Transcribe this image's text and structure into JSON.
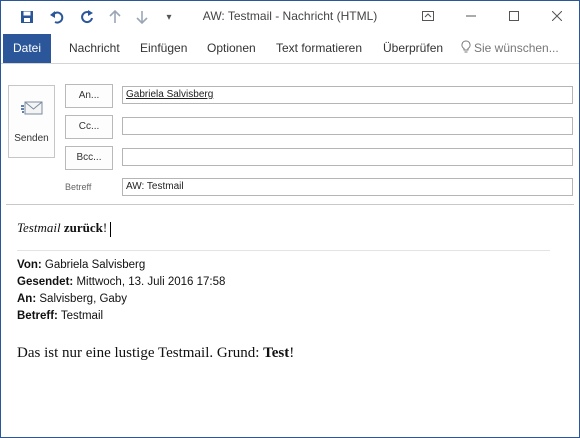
{
  "window": {
    "title": "AW: Testmail  -  Nachricht (HTML)"
  },
  "ribbon": {
    "tabs": [
      "Datei",
      "Nachricht",
      "Einfügen",
      "Optionen",
      "Text formatieren",
      "Überprüfen"
    ],
    "tell_me": "Sie wünschen..."
  },
  "header": {
    "send_label": "Senden",
    "to_label": "An...",
    "cc_label": "Cc...",
    "bcc_label": "Bcc...",
    "subject_label": "Betreff",
    "to_value": "Gabriela Salvisberg",
    "cc_value": "",
    "bcc_value": "",
    "subject_value": "AW: Testmail"
  },
  "body": {
    "reply_italic": "Testmail",
    "reply_bold": "zurück",
    "reply_end": "!",
    "from_label": "Von:",
    "from_value": "Gabriela Salvisberg",
    "sent_label": "Gesendet:",
    "sent_value": "Mittwoch, 13. Juli 2016 17:58",
    "to_label": "An:",
    "to_value": "Salvisberg, Gaby",
    "subject_label": "Betreff:",
    "subject_value": "Testmail",
    "quote_text": "Das ist nur eine lustige Testmail. Grund:",
    "quote_bold": "Test",
    "quote_end": "!"
  },
  "colors": {
    "accent": "#2b579a"
  }
}
